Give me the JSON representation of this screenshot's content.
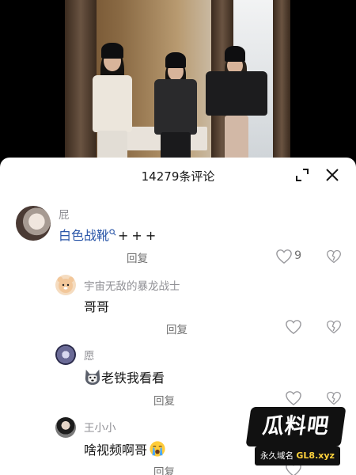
{
  "header": {
    "comment_count": "14279条评论"
  },
  "comments": [
    {
      "user": "屁",
      "text_highlight": "白色战靴",
      "text_rest": "+++",
      "reply_label": "回复",
      "like_count": "9"
    },
    {
      "user": "宇宙无敌的暴龙战士",
      "text": "哥哥",
      "reply_label": "回复"
    },
    {
      "user": "愿",
      "text": "老铁我看看",
      "text_emoji": "husky-face-emoji",
      "reply_label": "回复"
    },
    {
      "user": "王小小",
      "text": "啥视频啊哥",
      "text_emoji": "crying-face-emoji",
      "reply_label": "回复"
    }
  ],
  "watermark": {
    "title": "瓜料吧",
    "label": "永久域名",
    "domain": "GL8.xyz"
  },
  "colors": {
    "highlight": "#2a56a8",
    "muted": "#8f8f94",
    "text": "#161616"
  }
}
